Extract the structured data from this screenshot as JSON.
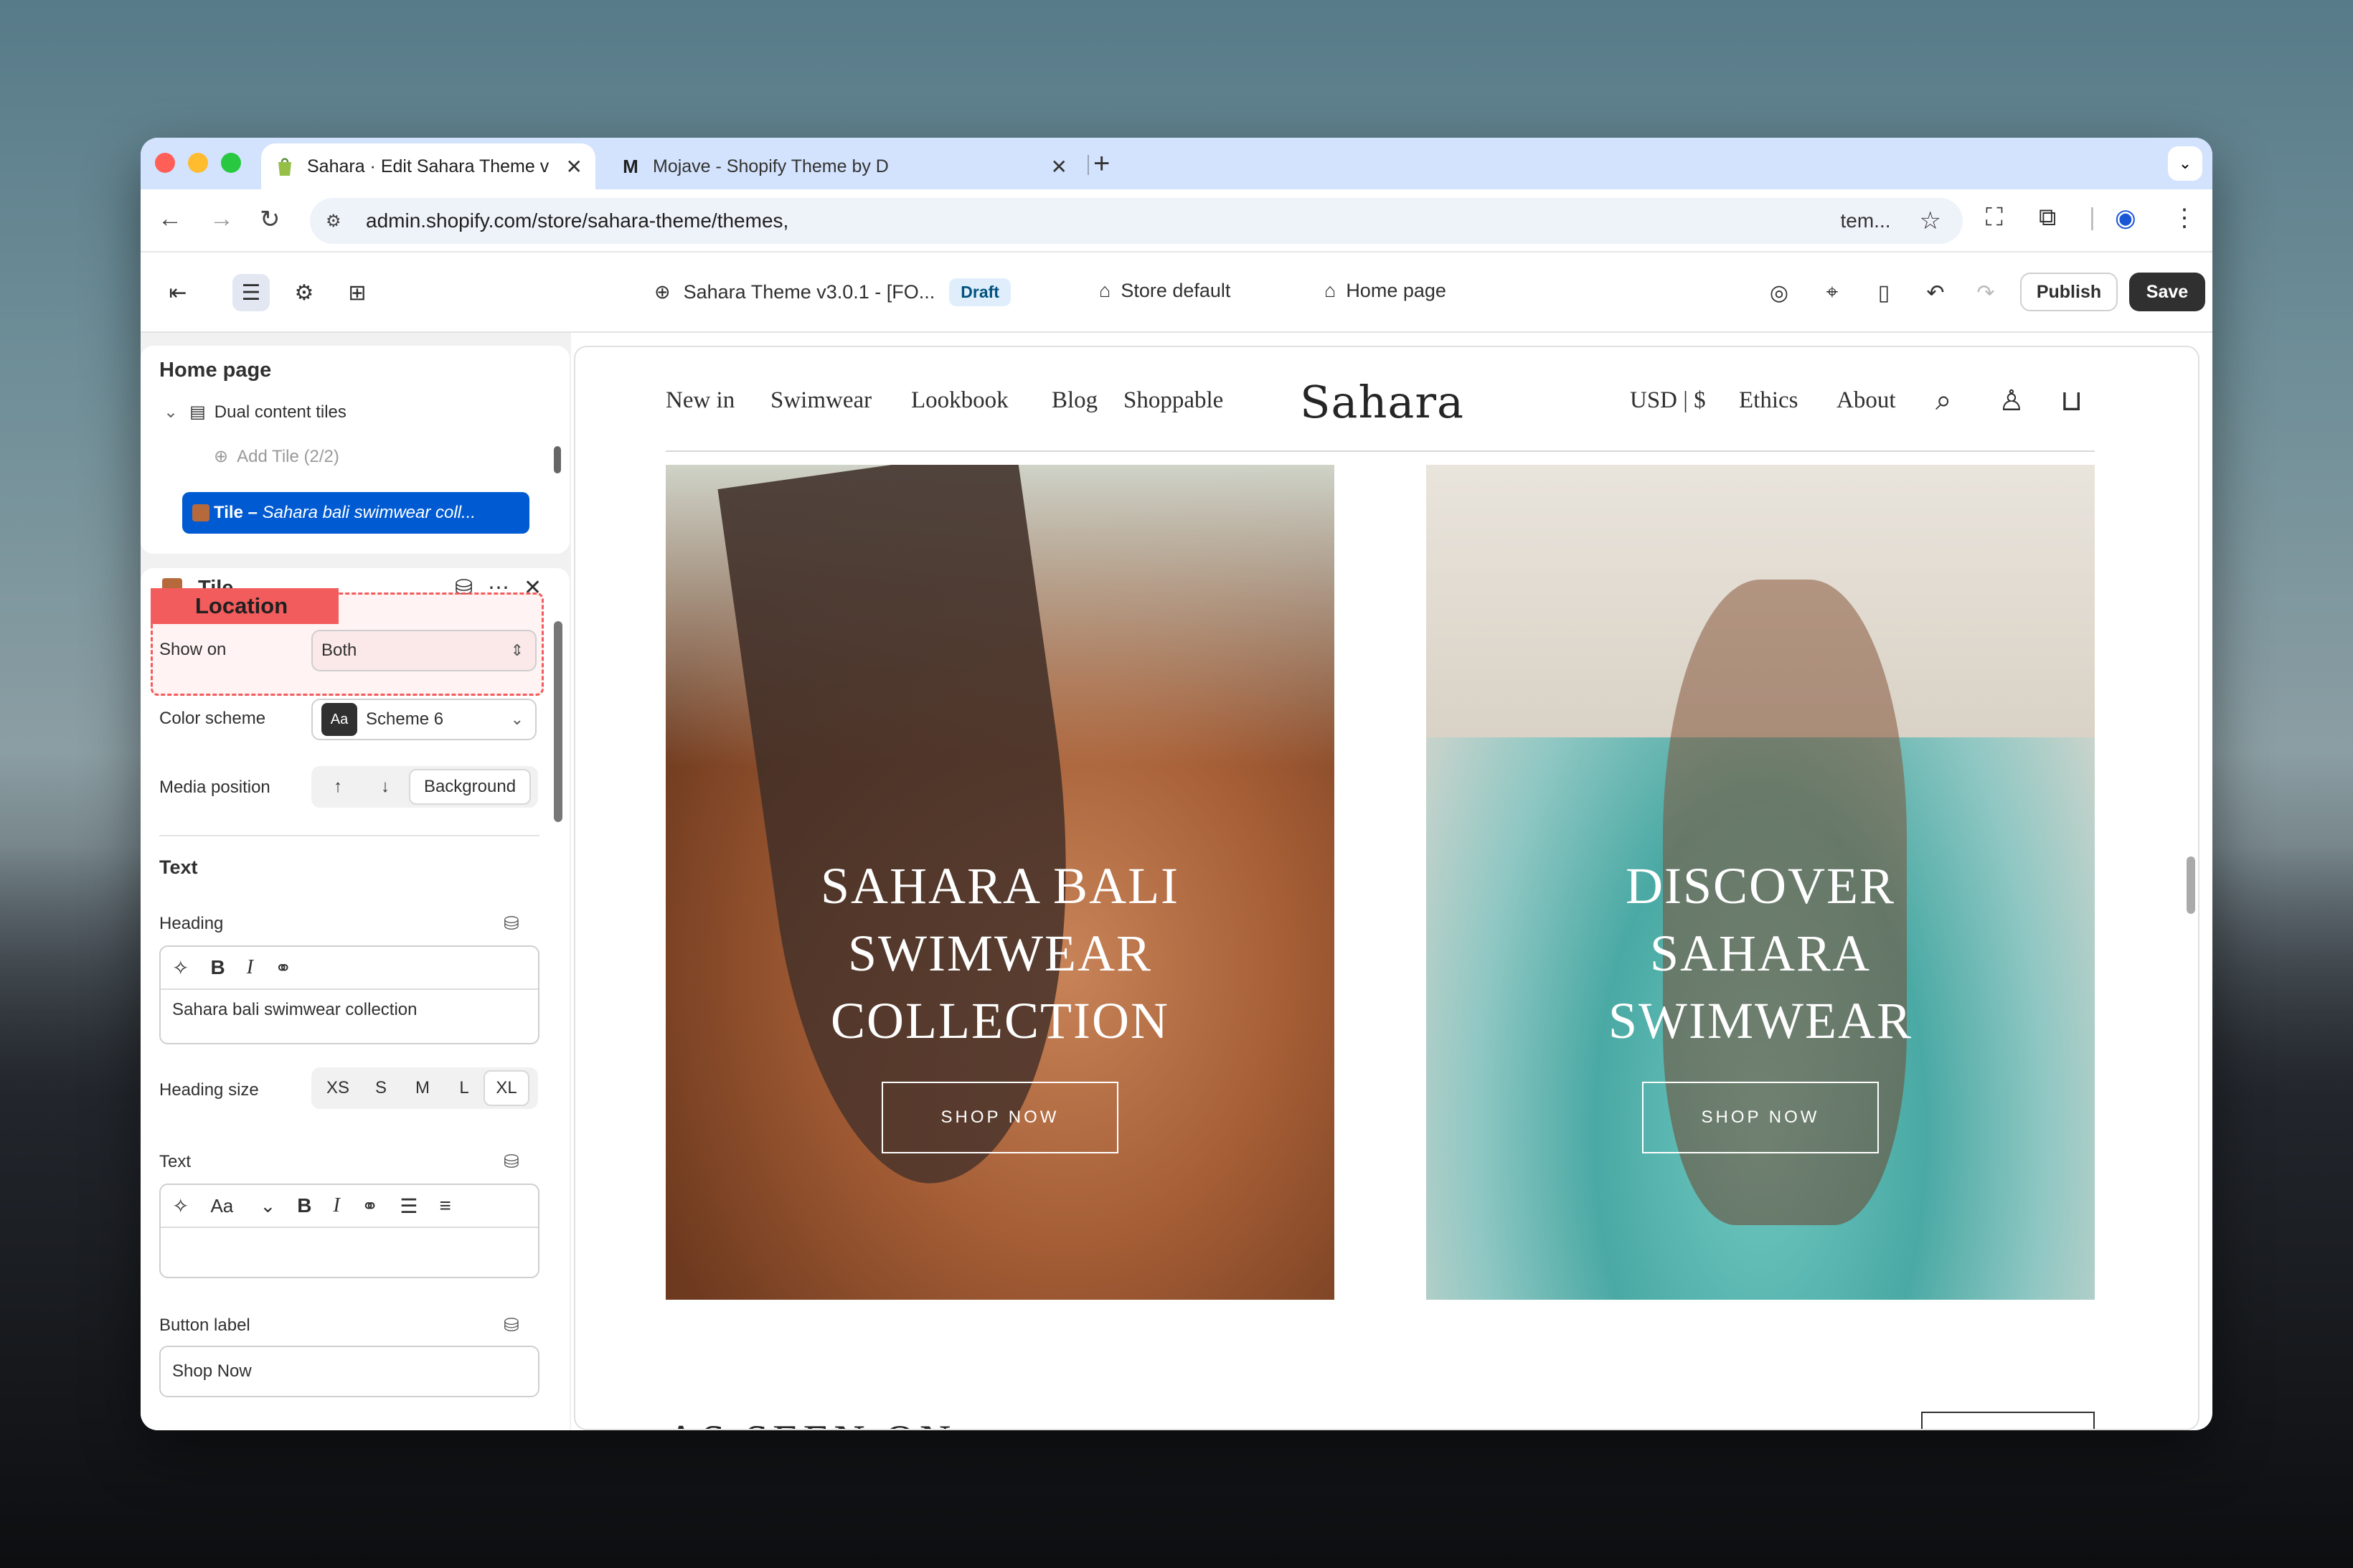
{
  "browser": {
    "tabs": [
      {
        "title": "Sahara · Edit Sahara Theme v",
        "favicon": "shopify-bag-icon",
        "active": true
      },
      {
        "title": "Mojave - Shopify Theme by D",
        "favicon": "M",
        "active": false
      }
    ],
    "url": "admin.shopify.com/store/sahara-theme/themes,",
    "url_suffix": "tem..."
  },
  "editor": {
    "theme_name": "Sahara Theme v3.0.1 - [FO...",
    "status_badge": "Draft",
    "store_default": "Store default",
    "page_selector": "Home page",
    "publish_label": "Publish",
    "save_label": "Save"
  },
  "sidebar": {
    "title": "Home page",
    "section": "Dual content tiles",
    "add_tile": "Add Tile (2/2)",
    "selected_tile_prefix": "Tile – ",
    "selected_tile_name": "Sahara bali swimwear coll..."
  },
  "settings": {
    "title": "Tile",
    "location_label": "Location",
    "show_on_label": "Show on",
    "show_on_value": "Both",
    "color_scheme_label": "Color scheme",
    "color_scheme_badge": "Aa",
    "color_scheme_value": "Scheme 6",
    "media_position_label": "Media position",
    "media_position_options": [
      "↑",
      "↓",
      "Background"
    ],
    "media_position_selected": "Background",
    "text_section": "Text",
    "heading_label": "Heading",
    "heading_value": "Sahara bali swimwear collection",
    "heading_size_label": "Heading size",
    "heading_sizes": [
      "XS",
      "S",
      "M",
      "L",
      "XL"
    ],
    "heading_size_selected": "XL",
    "text_label": "Text",
    "text_font_btn": "Aa",
    "button_label_label": "Button label",
    "button_label_value": "Shop Now"
  },
  "store": {
    "nav_left": [
      "New in",
      "Swimwear",
      "Lookbook",
      "Blog",
      "Shoppable"
    ],
    "logo": "Sahara",
    "nav_right": [
      "USD | $",
      "Ethics",
      "About"
    ],
    "tiles": [
      {
        "heading": "SAHARA BALI SWIMWEAR COLLECTION",
        "heading_lines": [
          "SAHARA BALI",
          "SWIMWEAR",
          "COLLECTION"
        ],
        "button": "SHOP NOW"
      },
      {
        "heading": "DISCOVER SAHARA SWIMWEAR",
        "heading_lines": [
          "DISCOVER",
          "SAHARA",
          "SWIMWEAR"
        ],
        "button": "SHOP NOW"
      }
    ],
    "as_seen_on": "AS SEEN ON"
  }
}
